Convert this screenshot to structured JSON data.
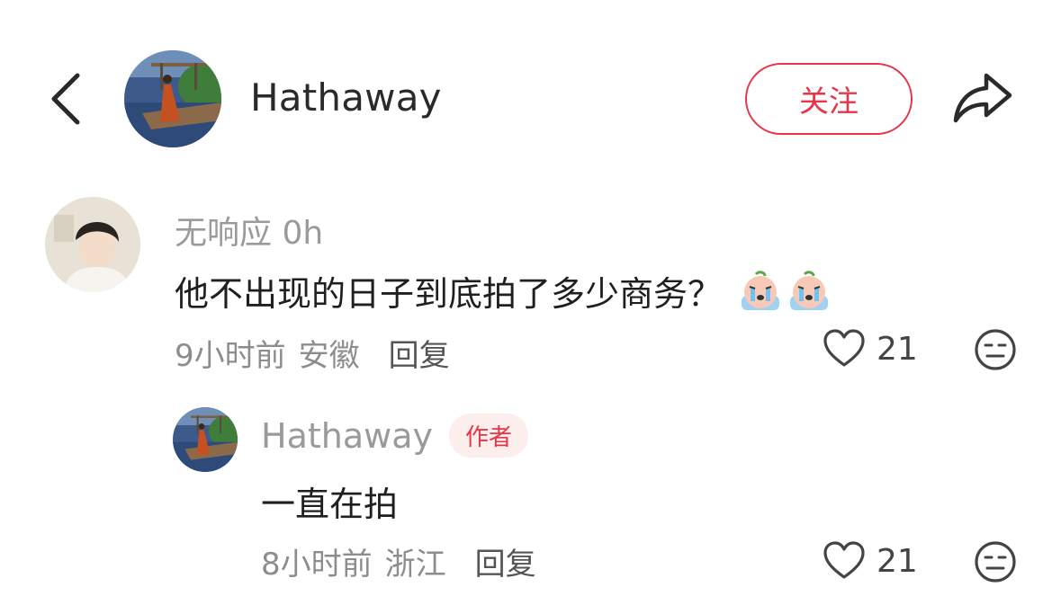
{
  "header": {
    "back_icon": "chevron-left-icon",
    "author_name": "Hathaway",
    "follow_label": "关注",
    "share_icon": "share-arrow-icon",
    "accent_color": "#e8344a"
  },
  "comment": {
    "user_name": "无响应 0h",
    "text": "他不出现的日子到底拍了多少商务？",
    "stickers": [
      "crying-sticker",
      "crying-sticker"
    ],
    "time": "9小时前",
    "location": "安徽",
    "reply_label": "回复",
    "likes": "21",
    "like_icon": "heart-outline-icon",
    "dislike_icon": "meh-face-icon"
  },
  "reply": {
    "user_name": "Hathaway",
    "badge": "作者",
    "text": "一直在拍",
    "time": "8小时前",
    "location": "浙江",
    "reply_label": "回复",
    "likes": "21",
    "like_icon": "heart-outline-icon",
    "dislike_icon": "meh-face-icon"
  }
}
